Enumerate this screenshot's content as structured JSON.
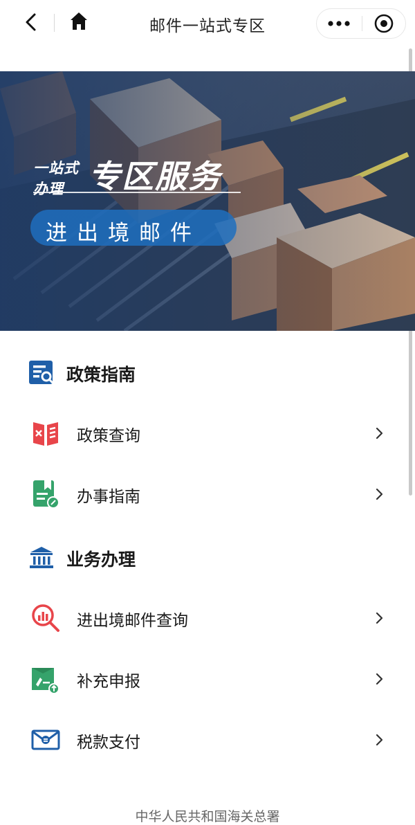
{
  "navbar": {
    "title": "邮件一站式专区",
    "icons": [
      "back-icon",
      "home-icon",
      "more-icon",
      "target-icon"
    ]
  },
  "banner": {
    "small_top": "一站式",
    "small_bottom": "办理",
    "title": "专区服务",
    "subtitle": "进出境邮件"
  },
  "sections": [
    {
      "title": "政策指南",
      "icon": "policy-guide-icon",
      "items": [
        {
          "label": "政策查询",
          "icon": "policy-book-icon"
        },
        {
          "label": "办事指南",
          "icon": "guide-document-icon"
        }
      ]
    },
    {
      "title": "业务办理",
      "icon": "government-building-icon",
      "items": [
        {
          "label": "进出境邮件查询",
          "icon": "magnifier-chart-icon"
        },
        {
          "label": "补充申报",
          "icon": "upload-document-icon"
        },
        {
          "label": "税款支付",
          "icon": "envelope-tax-icon"
        }
      ]
    }
  ],
  "footer": "中华人民共和国海关总署",
  "colors": {
    "primary_blue": "#1f5fa8",
    "red_icon": "#e8454a",
    "green_icon": "#35a36b",
    "banner_pill": "#1e6ebe"
  }
}
